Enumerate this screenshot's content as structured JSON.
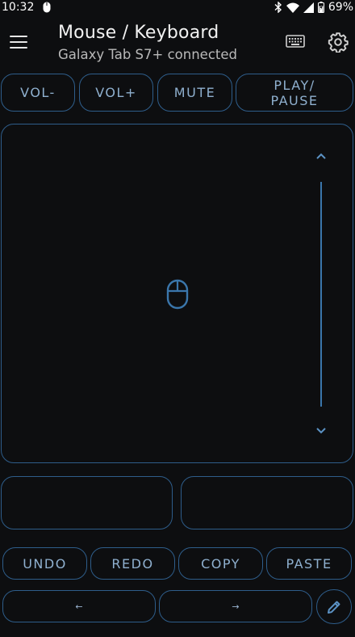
{
  "status_bar": {
    "time": "10:32",
    "battery": "69%"
  },
  "app_bar": {
    "title": "Mouse / Keyboard",
    "subtitle": "Galaxy Tab S7+ connected"
  },
  "media_buttons": {
    "vol_down": "VOL-",
    "vol_up": "VOL+",
    "mute": "MUTE",
    "play_pause_line1": "PLAY/",
    "play_pause_line2": "PAUSE"
  },
  "edit_buttons": {
    "undo": "UNDO",
    "redo": "REDO",
    "copy": "COPY",
    "paste": "PASTE"
  },
  "nav_buttons": {
    "left_arrow": "←",
    "right_arrow": "→"
  },
  "colors": {
    "accent": "#3a76ab",
    "border": "#2e5d8a",
    "button_text": "#8fb0cf",
    "background": "#0d0e10"
  },
  "icons": [
    "menu-icon",
    "keyboard-icon",
    "gear-icon",
    "mouse-icon",
    "chevron-up-icon",
    "chevron-down-icon",
    "pencil-icon"
  ]
}
